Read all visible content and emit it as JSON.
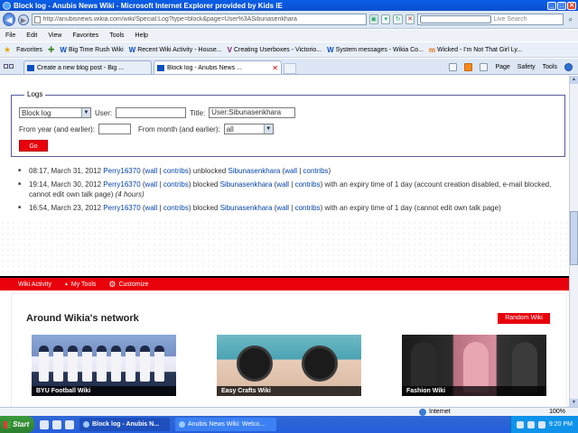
{
  "window": {
    "title": "Block log - Anubis News Wiki - Microsoft Internet Explorer provided by Kids IE"
  },
  "address": {
    "url": "http://anubisnews.wikia.com/wiki/Special:Log?type=block&page=User%3ASibunasenkhara",
    "search_placeholder": "Live Search"
  },
  "menu": [
    "File",
    "Edit",
    "View",
    "Favorites",
    "Tools",
    "Help"
  ],
  "favorites": {
    "label": "Favorites",
    "links": [
      {
        "text": "Big Time Rush Wiki",
        "icon": "W"
      },
      {
        "text": "Recent Wiki Activity - House...",
        "icon": "W"
      },
      {
        "text": "Creating Userboxes - Victorio...",
        "icon": "V"
      },
      {
        "text": "System messages - Wikia Co...",
        "icon": "W"
      },
      {
        "text": "Wicked - I'm Not That Girl Ly...",
        "icon": "m"
      }
    ]
  },
  "tabs": [
    {
      "label": "Create a new blog post - Big ..."
    },
    {
      "label": "Block log - Anubis News ...",
      "close": "✕"
    }
  ],
  "command_bar": {
    "page": "Page",
    "safety": "Safety",
    "tools": "Tools"
  },
  "logs_form": {
    "legend": "Logs",
    "type_value": "Block log",
    "user_label": "User:",
    "user_value": "",
    "title_label": "Title:",
    "title_value": "User:Sibunasenkhara",
    "year_label": "From year (and earlier):",
    "year_value": "",
    "month_label": "From month (and earlier):",
    "month_value": "all",
    "go_label": "Go"
  },
  "entries": [
    {
      "time": "08:17, March 31, 2012",
      "user": "Perry16370",
      "wall": "wall",
      "contribs": "contribs",
      "action": "unblocked",
      "target": "Sibunasenkhara",
      "rest": ""
    },
    {
      "time": "19:14, March 30, 2012",
      "user": "Perry16370",
      "wall": "wall",
      "contribs": "contribs",
      "action": "blocked",
      "target": "Sibunasenkhara",
      "rest": "with an expiry time of 1 day (account creation disabled, e-mail blocked, cannot edit own talk page)",
      "duration": "(4 hours)"
    },
    {
      "time": "16:54, March 23, 2012",
      "user": "Perry16370",
      "wall": "wall",
      "contribs": "contribs",
      "action": "blocked",
      "target": "Sibunasenkhara",
      "rest": "with an expiry time of 1 day (cannot edit own talk page)"
    }
  ],
  "wiki_toolbar": {
    "activity": "Wiki Activity",
    "my_tools": "My Tools",
    "customize": "Customize"
  },
  "network": {
    "title": "Around Wikia's network",
    "random_button": "Random Wiki",
    "tiles": [
      {
        "caption": "BYU Football Wiki"
      },
      {
        "caption": "Easy Crafts Wiki"
      },
      {
        "caption": "Fashion Wiki"
      }
    ]
  },
  "status": {
    "zone": "Internet",
    "zoom": "100%"
  },
  "taskbar": {
    "start": "Start",
    "tasks": [
      {
        "label": "Block log - Anubis N..."
      },
      {
        "label": "Anubis News Wiki: Welco..."
      }
    ],
    "clock": "9:20 PM"
  }
}
